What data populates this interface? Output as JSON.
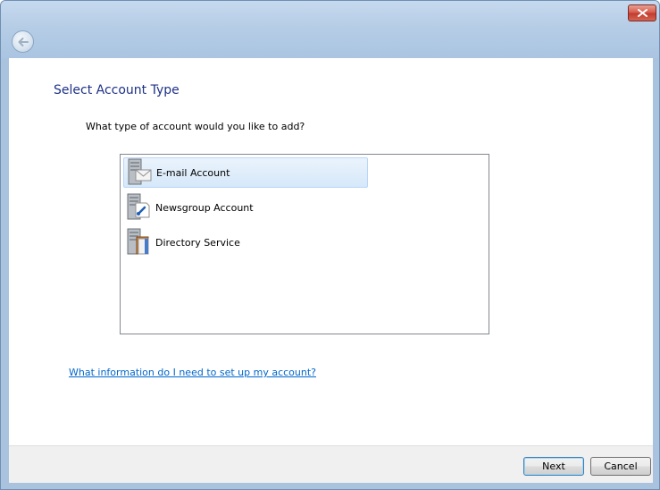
{
  "window": {
    "close_label": "close"
  },
  "page": {
    "title": "Select Account Type",
    "question": "What type of account would you like to add?",
    "account_types": [
      {
        "label": "E-mail Account",
        "icon": "email-account-icon",
        "selected": true
      },
      {
        "label": "Newsgroup Account",
        "icon": "newsgroup-account-icon",
        "selected": false
      },
      {
        "label": "Directory Service",
        "icon": "directory-service-icon",
        "selected": false
      }
    ],
    "help_link": "What information do I need to set up my account?"
  },
  "footer": {
    "next_label": "Next",
    "cancel_label": "Cancel"
  },
  "colors": {
    "title": "#1e3287",
    "link": "#0066cc",
    "selection": "#d6e8f9"
  }
}
